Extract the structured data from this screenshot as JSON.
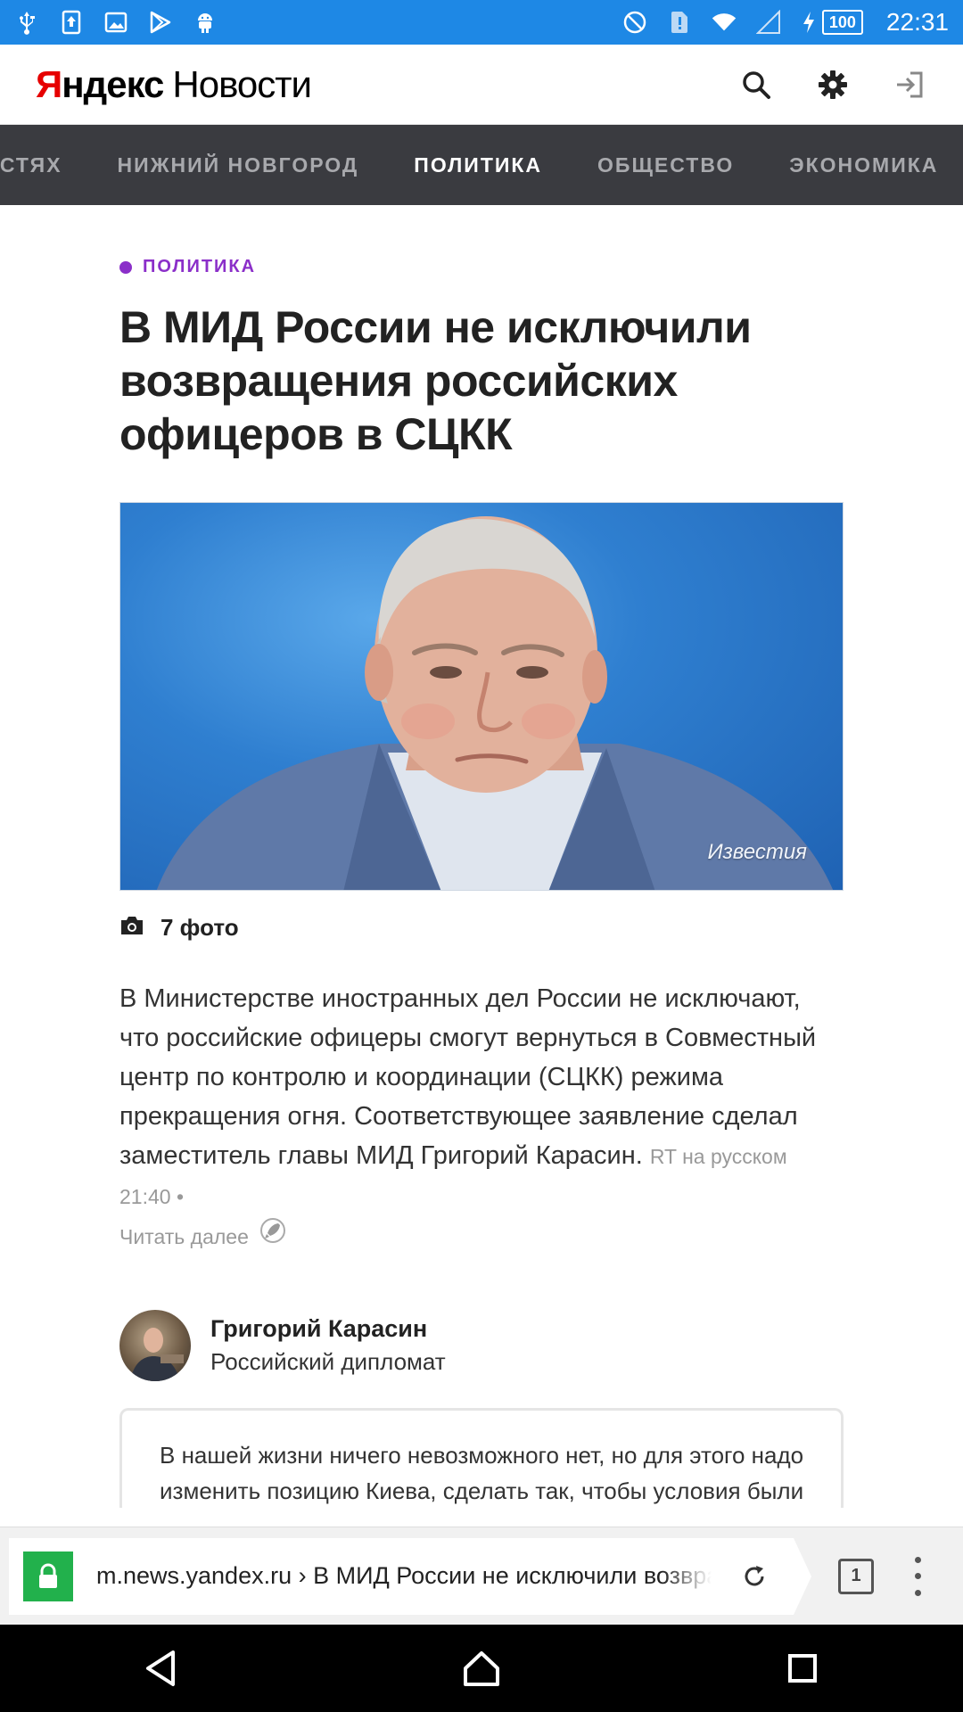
{
  "status_bar": {
    "time": "22:31",
    "battery": "100",
    "left_icons": [
      "usb-icon",
      "upload-icon",
      "image-icon",
      "play-store-icon",
      "android-icon"
    ],
    "right_icons": [
      "do-not-disturb-icon",
      "sim-alert-icon",
      "wifi-icon",
      "signal-icon",
      "charging-icon"
    ],
    "color": "#1e88e5"
  },
  "header": {
    "logo_yandex_first": "Я",
    "logo_yandex_rest": "ндекс",
    "logo_news": "Новости",
    "icons": [
      "search-icon",
      "gear-icon",
      "login-icon"
    ]
  },
  "categories": {
    "items": [
      "ОСТЯХ",
      "НИЖНИЙ НОВГОРОД",
      "ПОЛИТИКА",
      "ОБЩЕСТВО",
      "ЭКОНОМИКА"
    ],
    "active": "ПОЛИТИКА"
  },
  "article": {
    "rubric": "ПОЛИТИКА",
    "rubric_color": "#8b2fc9",
    "title": "В МИД России не исключили возвращения российских офицеров в СЦКК",
    "photo_credit": "Известия",
    "photo_count": "7 фото",
    "lead": "В Министерстве иностранных дел России не исключают, что российские офицеры смогут вернуться в Совместный центр по контролю и координации (СЦКК) режима прекращения огня. Соответствующее заявление сделал заместитель главы МИД Григорий Карасин.",
    "source_meta": "RT на русском 21:40 •",
    "read_more": "Читать далее"
  },
  "quote": {
    "person_name": "Григорий Карасин",
    "person_role": "Российский дипломат",
    "text": "В нашей жизни ничего невозможного нет, но для этого надо изменить позицию Киева, сделать так, чтобы условия были гарантированными, а не зависели от"
  },
  "browser": {
    "url": "m.news.yandex.ru › В МИД России не исключили возвращения",
    "tab_count": "1",
    "lock_color": "#22b14c"
  },
  "nav_bar": {
    "buttons": [
      "back-icon",
      "home-icon",
      "recents-icon"
    ]
  }
}
